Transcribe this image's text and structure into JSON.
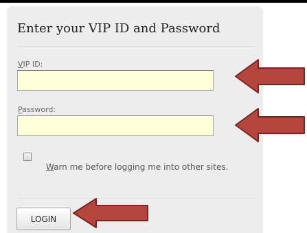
{
  "login_form": {
    "title": "Enter your VIP ID and Password",
    "vip_id": {
      "label_key": "V",
      "label_rest": "IP ID:",
      "value": ""
    },
    "password": {
      "label_key": "P",
      "label_rest": "assword:",
      "value": ""
    },
    "warn_checkbox": {
      "checked": false,
      "label_key": "W",
      "label_rest": "arn me before logging me into other sites."
    },
    "login_button_label": "LOGIN"
  },
  "colors": {
    "panel_background": "#ededed",
    "input_background": "#ffffd9",
    "arrow_fill": "#b5453d",
    "arrow_outline": "#7a2420"
  }
}
